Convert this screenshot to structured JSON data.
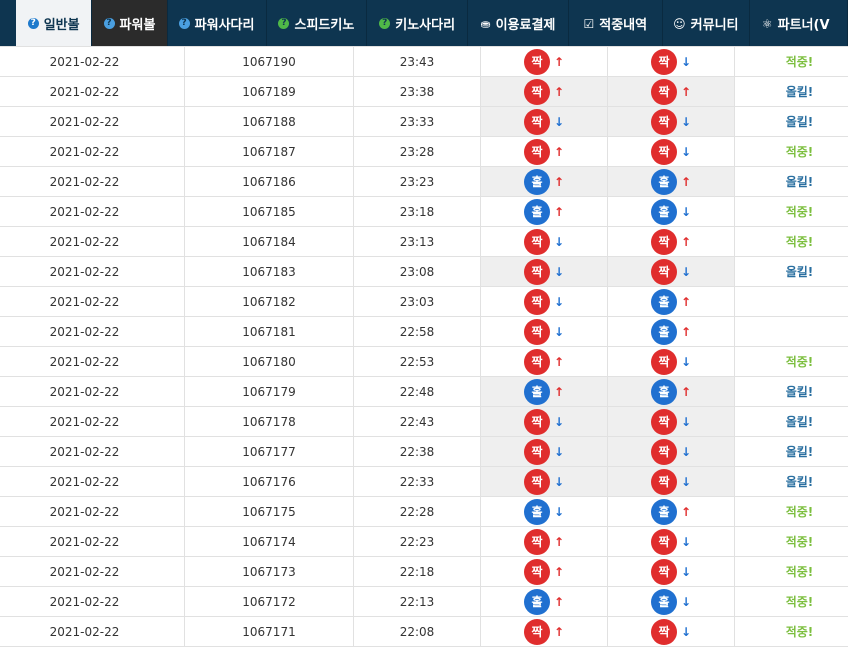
{
  "nav": {
    "items": [
      {
        "label": "일반볼",
        "icon": "question-icon",
        "state": "active"
      },
      {
        "label": "파워볼",
        "icon": "question-icon",
        "state": "dark"
      },
      {
        "label": "파워사다리",
        "icon": "question-icon",
        "state": ""
      },
      {
        "label": "스피드키노",
        "icon": "question-icon",
        "state": ""
      },
      {
        "label": "키노사다리",
        "icon": "question-icon",
        "state": ""
      },
      {
        "label": "이용료결제",
        "icon": "coins-icon",
        "state": ""
      },
      {
        "label": "적중내역",
        "icon": "checkbox-icon",
        "state": ""
      },
      {
        "label": "커뮤니티",
        "icon": "smile-icon",
        "state": ""
      },
      {
        "label": "파트너(V",
        "icon": "partner-icon",
        "state": ""
      }
    ]
  },
  "colors": {
    "nav_bg": "#0e3550",
    "odd": "#e02d2d",
    "even": "#2070d0",
    "hit": "#7cbf3f",
    "miss": "#2a6fa0"
  },
  "results": {
    "rows": [
      {
        "date": "2021-02-22",
        "round": "1067190",
        "time": "23:43",
        "p1": "짝",
        "a1": "up",
        "p2": "짝",
        "a2": "down",
        "status": "적중!"
      },
      {
        "date": "2021-02-22",
        "round": "1067189",
        "time": "23:38",
        "p1": "짝",
        "a1": "up",
        "p2": "짝",
        "a2": "up",
        "status": "올킬!"
      },
      {
        "date": "2021-02-22",
        "round": "1067188",
        "time": "23:33",
        "p1": "짝",
        "a1": "down",
        "p2": "짝",
        "a2": "down",
        "status": "올킬!"
      },
      {
        "date": "2021-02-22",
        "round": "1067187",
        "time": "23:28",
        "p1": "짝",
        "a1": "up",
        "p2": "짝",
        "a2": "down",
        "status": "적중!"
      },
      {
        "date": "2021-02-22",
        "round": "1067186",
        "time": "23:23",
        "p1": "홀",
        "a1": "up",
        "p2": "홀",
        "a2": "up",
        "status": "올킬!"
      },
      {
        "date": "2021-02-22",
        "round": "1067185",
        "time": "23:18",
        "p1": "홀",
        "a1": "up",
        "p2": "홀",
        "a2": "down",
        "status": "적중!"
      },
      {
        "date": "2021-02-22",
        "round": "1067184",
        "time": "23:13",
        "p1": "짝",
        "a1": "down",
        "p2": "짝",
        "a2": "up",
        "status": "적중!"
      },
      {
        "date": "2021-02-22",
        "round": "1067183",
        "time": "23:08",
        "p1": "짝",
        "a1": "down",
        "p2": "짝",
        "a2": "down",
        "status": "올킬!"
      },
      {
        "date": "2021-02-22",
        "round": "1067182",
        "time": "23:03",
        "p1": "짝",
        "a1": "down",
        "p2": "홀",
        "a2": "up",
        "status": ""
      },
      {
        "date": "2021-02-22",
        "round": "1067181",
        "time": "22:58",
        "p1": "짝",
        "a1": "down",
        "p2": "홀",
        "a2": "up",
        "status": ""
      },
      {
        "date": "2021-02-22",
        "round": "1067180",
        "time": "22:53",
        "p1": "짝",
        "a1": "up",
        "p2": "짝",
        "a2": "down",
        "status": "적중!"
      },
      {
        "date": "2021-02-22",
        "round": "1067179",
        "time": "22:48",
        "p1": "홀",
        "a1": "up",
        "p2": "홀",
        "a2": "up",
        "status": "올킬!"
      },
      {
        "date": "2021-02-22",
        "round": "1067178",
        "time": "22:43",
        "p1": "짝",
        "a1": "down",
        "p2": "짝",
        "a2": "down",
        "status": "올킬!"
      },
      {
        "date": "2021-02-22",
        "round": "1067177",
        "time": "22:38",
        "p1": "짝",
        "a1": "down",
        "p2": "짝",
        "a2": "down",
        "status": "올킬!"
      },
      {
        "date": "2021-02-22",
        "round": "1067176",
        "time": "22:33",
        "p1": "짝",
        "a1": "down",
        "p2": "짝",
        "a2": "down",
        "status": "올킬!"
      },
      {
        "date": "2021-02-22",
        "round": "1067175",
        "time": "22:28",
        "p1": "홀",
        "a1": "down",
        "p2": "홀",
        "a2": "up",
        "status": "적중!"
      },
      {
        "date": "2021-02-22",
        "round": "1067174",
        "time": "22:23",
        "p1": "짝",
        "a1": "up",
        "p2": "짝",
        "a2": "down",
        "status": "적중!"
      },
      {
        "date": "2021-02-22",
        "round": "1067173",
        "time": "22:18",
        "p1": "짝",
        "a1": "up",
        "p2": "짝",
        "a2": "down",
        "status": "적중!"
      },
      {
        "date": "2021-02-22",
        "round": "1067172",
        "time": "22:13",
        "p1": "홀",
        "a1": "up",
        "p2": "홀",
        "a2": "down",
        "status": "적중!"
      },
      {
        "date": "2021-02-22",
        "round": "1067171",
        "time": "22:08",
        "p1": "짝",
        "a1": "up",
        "p2": "짝",
        "a2": "down",
        "status": "적중!"
      }
    ]
  }
}
